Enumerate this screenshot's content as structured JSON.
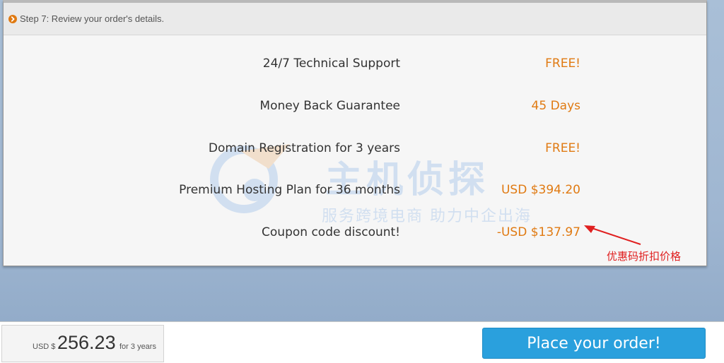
{
  "step": {
    "label": "Step 7: Review your order's details."
  },
  "order_items": [
    {
      "label": "24/7 Technical Support",
      "value": "FREE!"
    },
    {
      "label": "Money Back Guarantee",
      "value": "45 Days"
    },
    {
      "label": "Domain Registration for 3 years",
      "value": "FREE!"
    },
    {
      "label": "Premium Hosting Plan for 36 months",
      "value": "USD $394.20"
    },
    {
      "label": "Coupon code discount!",
      "value": "-USD $137.97"
    }
  ],
  "watermark": {
    "title": "主机侦探",
    "subtitle": "服务跨境电商 助力中企出海"
  },
  "annotation": {
    "text": "优惠码折扣价格"
  },
  "total": {
    "currency": "USD $",
    "amount": "256.23",
    "term": "for 3 years"
  },
  "actions": {
    "place_order": "Place your order!"
  },
  "colors": {
    "accent": "#e07a12",
    "button": "#2aa0dd",
    "annotation": "#e02020"
  }
}
